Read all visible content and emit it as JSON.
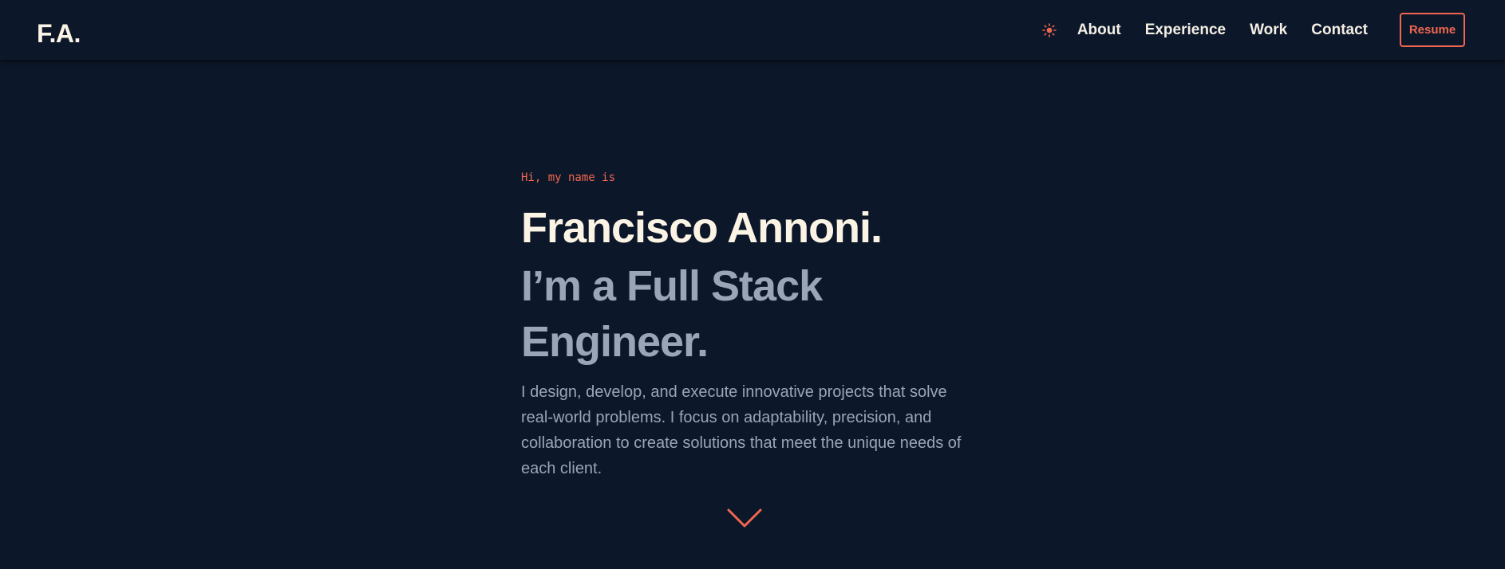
{
  "header": {
    "logo": "F.A.",
    "theme_toggle_icon": "sun-icon",
    "nav_links": [
      {
        "label": "About"
      },
      {
        "label": "Experience"
      },
      {
        "label": "Work"
      },
      {
        "label": "Contact"
      }
    ],
    "resume_label": "Resume"
  },
  "hero": {
    "intro": "Hi, my name is",
    "name": "Francisco Annoni.",
    "tagline": "I’m a Full Stack Engineer.",
    "description": "I design, develop, and execute innovative projects that solve real-world problems. I focus on adaptability, precision, and collaboration to create solutions that meet the unique needs of each client.",
    "scroll_icon": "chevron-down-icon"
  },
  "colors": {
    "background": "#0c182a",
    "accent": "#f26650",
    "heading": "#fbf4e4",
    "muted": "#9aa5b8"
  }
}
